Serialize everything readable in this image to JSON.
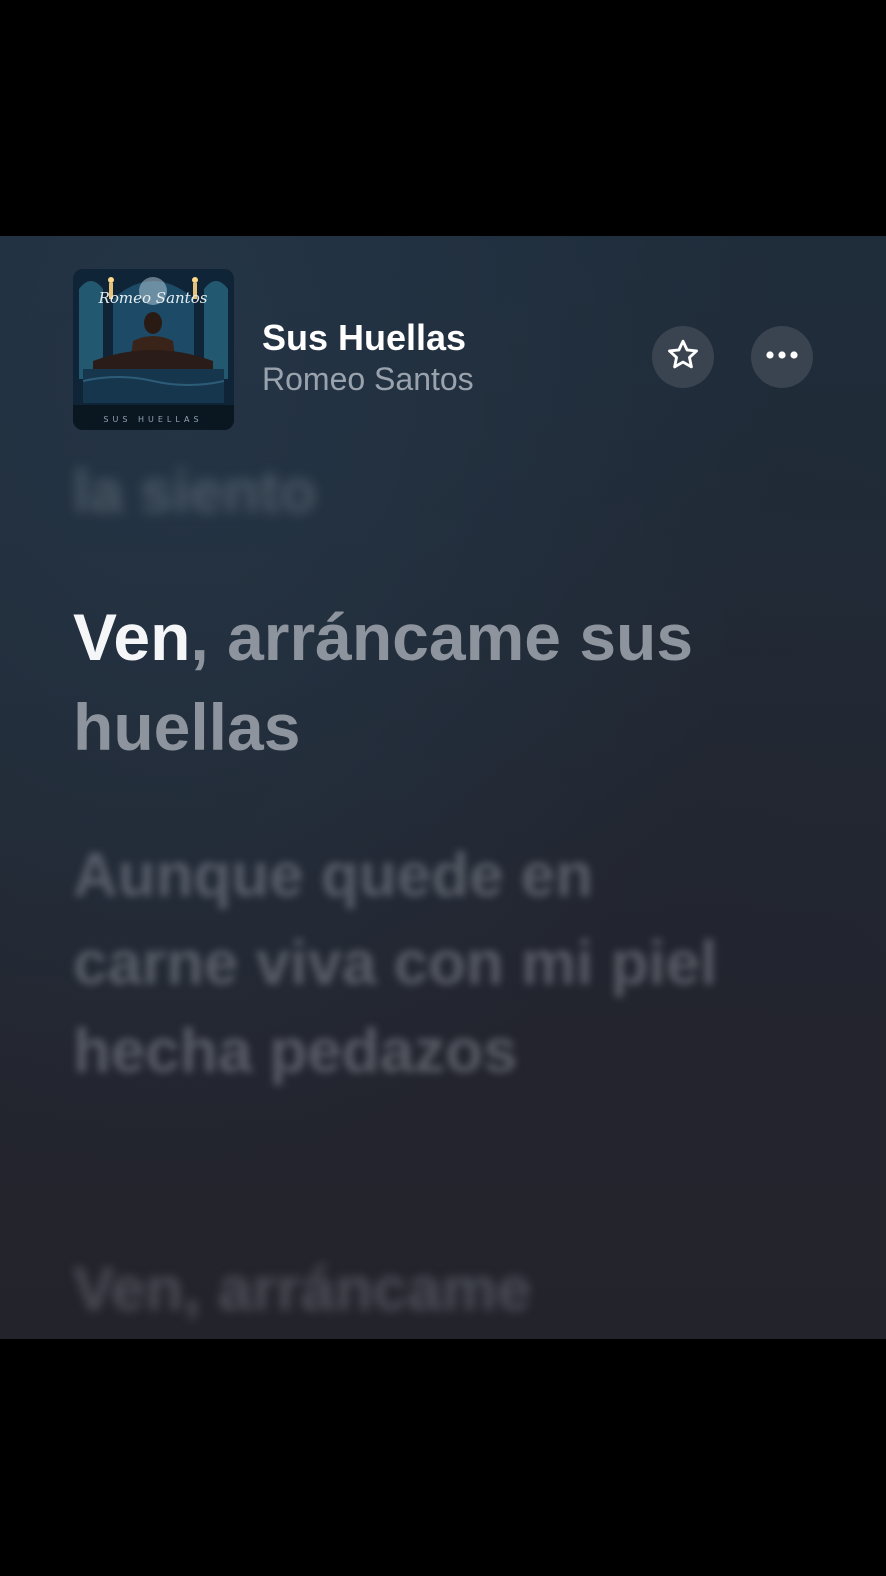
{
  "now_playing": {
    "title": "Sus Huellas",
    "artist": "Romeo Santos",
    "album_cover_text_top": "Romeo Santos",
    "album_cover_text_bottom": "SUS HUELLAS"
  },
  "actions": {
    "favorite_icon": "star-icon",
    "more_icon": "ellipsis-icon"
  },
  "lyrics": {
    "previous_line": "la siento",
    "current_line_sung": "Ven",
    "current_line_rest": ", arráncame sus huellas",
    "next_line": "Aunque quede en carne viva con mi piel hecha pedazos",
    "following_line": "Ven, arráncame"
  },
  "colors": {
    "background_top": "#1f2c3a",
    "background_bottom": "#23232b",
    "sung_text": "#f4f6f8",
    "unsung_text": "#8d949d",
    "button_bg": "#3a4450"
  }
}
